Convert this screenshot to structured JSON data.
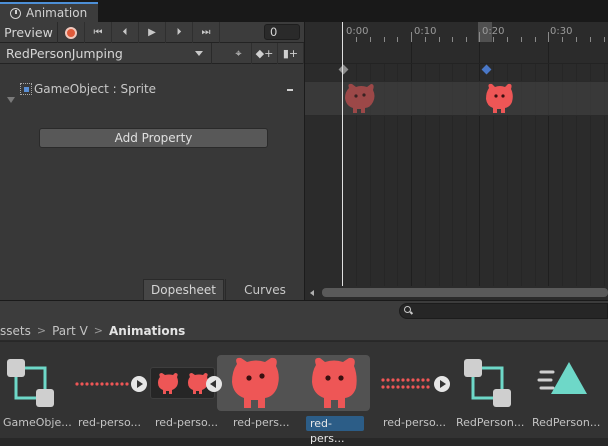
{
  "window": {
    "tab_title": "Animation"
  },
  "toolbar": {
    "preview_label": "Preview",
    "frame_value": "0",
    "clip_name": "RedPersonJumping",
    "icons": [
      "record-icon",
      "first-key-icon",
      "prev-key-icon",
      "play-icon",
      "next-key-icon",
      "last-key-icon",
      "key-filter-icon",
      "add-keyframe-icon",
      "add-event-icon"
    ]
  },
  "properties": [
    {
      "label": "GameObject : Sprite"
    }
  ],
  "add_property_label": "Add Property",
  "view_tabs": {
    "dopesheet": "Dopesheet",
    "curves": "Curves"
  },
  "timeline": {
    "ticks": [
      "0:00",
      "0:10",
      "0:20",
      "0:30"
    ]
  },
  "breadcrumb": {
    "parts": [
      "ssets",
      "Part V",
      "Animations"
    ]
  },
  "assets": [
    {
      "label": "GameObje..."
    },
    {
      "label": "red-perso..."
    },
    {
      "label": "red-perso..."
    },
    {
      "label": "red-pers..."
    },
    {
      "label": "red-pers..."
    },
    {
      "label": "red-perso..."
    },
    {
      "label": "RedPerson..."
    },
    {
      "label": "RedPerson..."
    }
  ],
  "colors": {
    "accent": "#4d8fd6",
    "record": "#e05a3a",
    "sprite_red": "#ee5656",
    "selection": "#2c5d87",
    "teal": "#6ed8c8"
  }
}
